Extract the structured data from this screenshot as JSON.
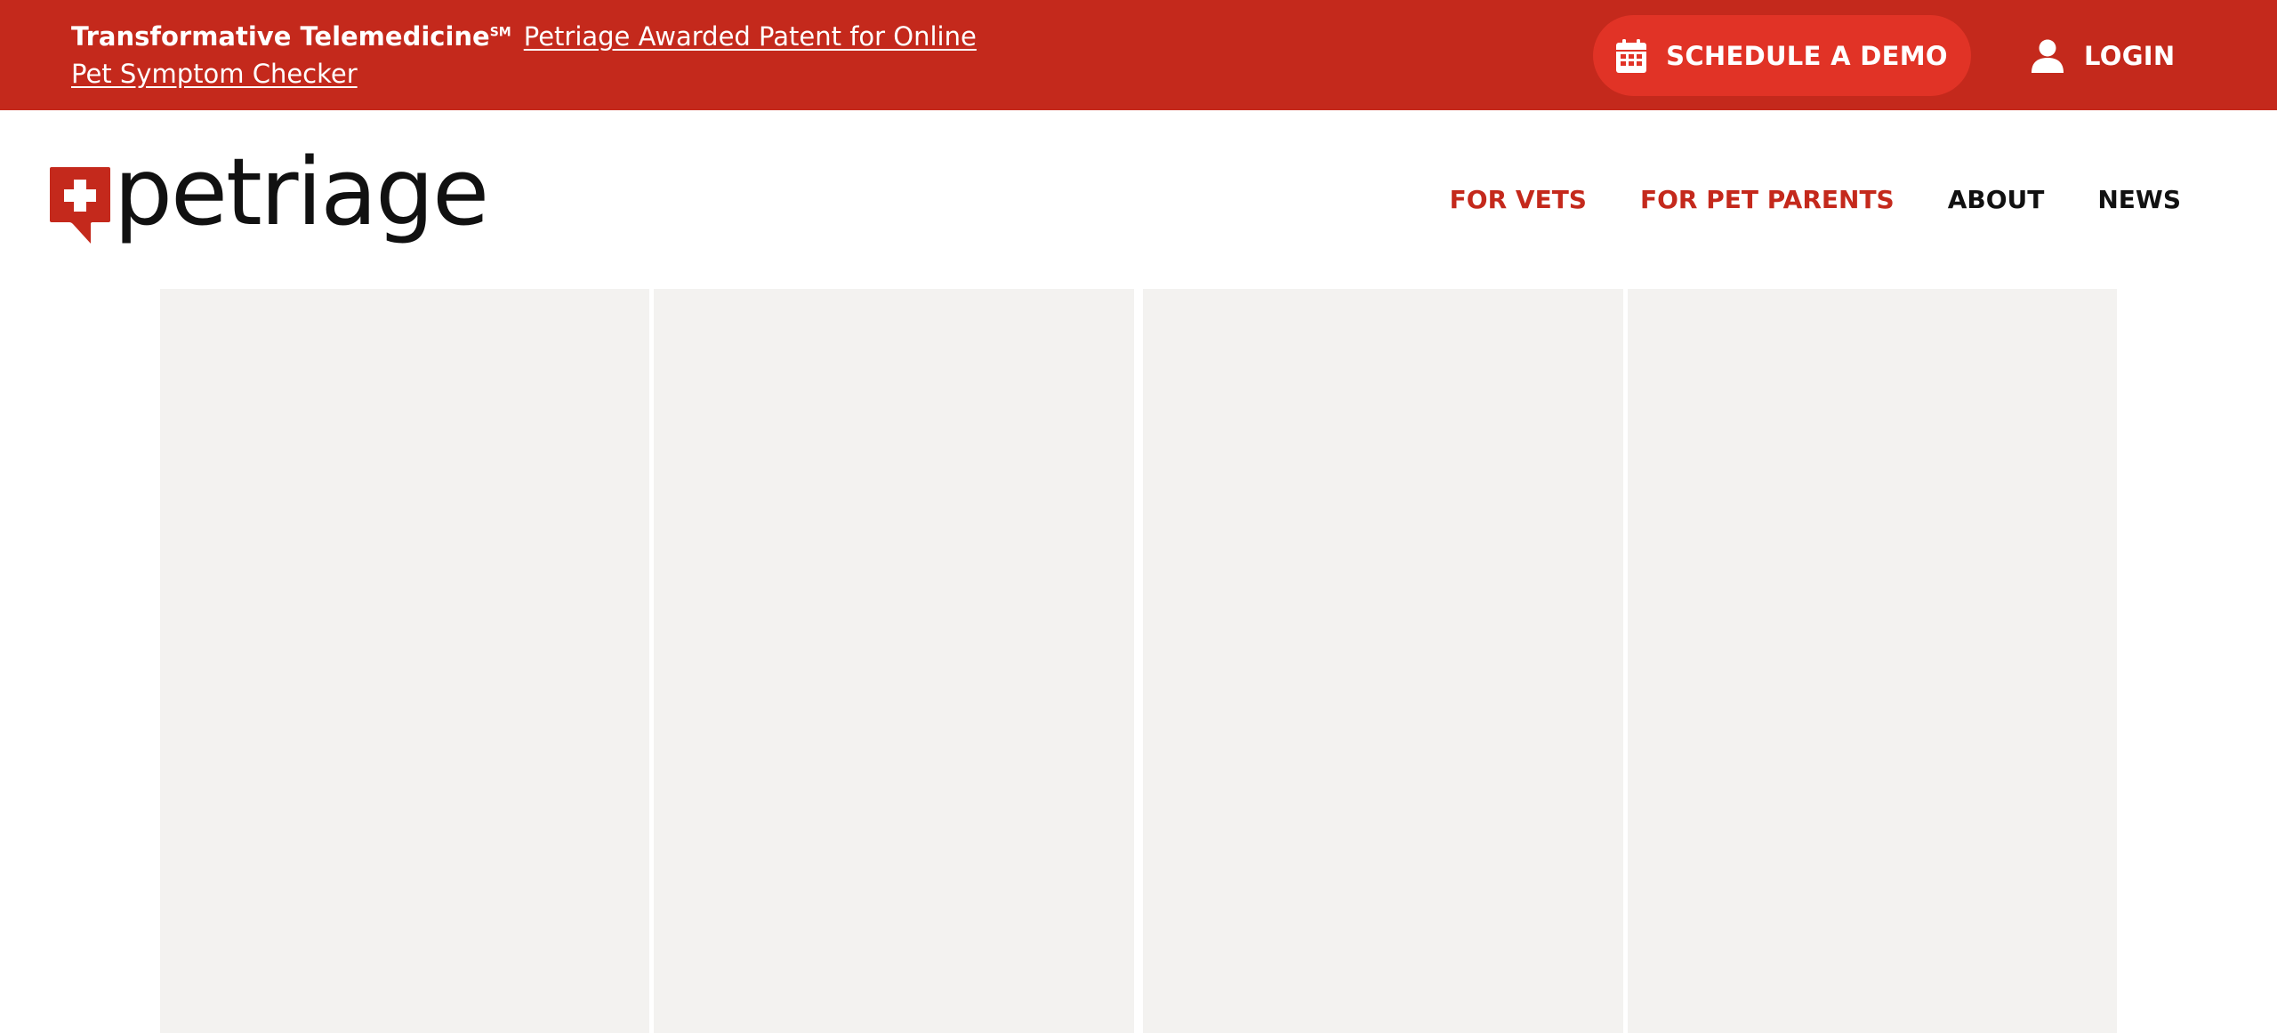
{
  "topbar": {
    "tagline": "Transformative Telemedicine",
    "tagline_mark": "SM",
    "news_link": "Petriage Awarded Patent for Online Pet Symptom Checker",
    "demo_label": "SCHEDULE A DEMO",
    "demo_icon": "calendar-icon",
    "login_label": "LOGIN",
    "login_icon": "user-icon",
    "bg_color": "#c4291c",
    "button_color": "#e13326"
  },
  "header": {
    "logo_text": "petriage",
    "logo_icon": "medical-cross-chat-bubble-icon",
    "nav": [
      {
        "label": "FOR VETS",
        "color": "#c4291c"
      },
      {
        "label": "FOR PET PARENTS",
        "color": "#c4291c"
      },
      {
        "label": "ABOUT",
        "color": "#111111"
      },
      {
        "label": "NEWS",
        "color": "#111111"
      }
    ]
  },
  "main": {
    "panel_count": 4,
    "panel_color": "#f3f2f0"
  }
}
